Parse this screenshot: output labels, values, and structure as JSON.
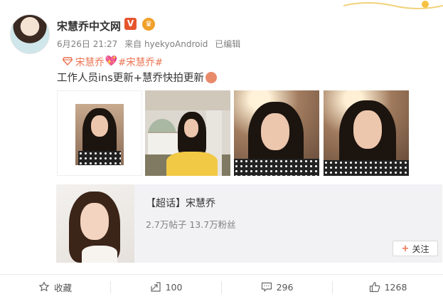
{
  "post": {
    "author": "宋慧乔中文网",
    "verified_mark": "V",
    "date": "6月26日 21:27",
    "source": "来自 hyekyoAndroid",
    "edited": "已编辑",
    "tag_line": {
      "part1": "宋慧乔",
      "part2": "#宋慧乔#"
    },
    "body": "工作人员ins更新+慧乔快拍更新"
  },
  "topic_card": {
    "title": "【超话】宋慧乔",
    "stats": "2.7万帖子 13.7万粉丝",
    "follow_label": "关注"
  },
  "actions": {
    "favorite_label": "收藏",
    "repost_count": "100",
    "comment_count": "296",
    "like_count": "1268"
  },
  "colors": {
    "accent": "#eb7350",
    "verified": "#e6552d"
  }
}
